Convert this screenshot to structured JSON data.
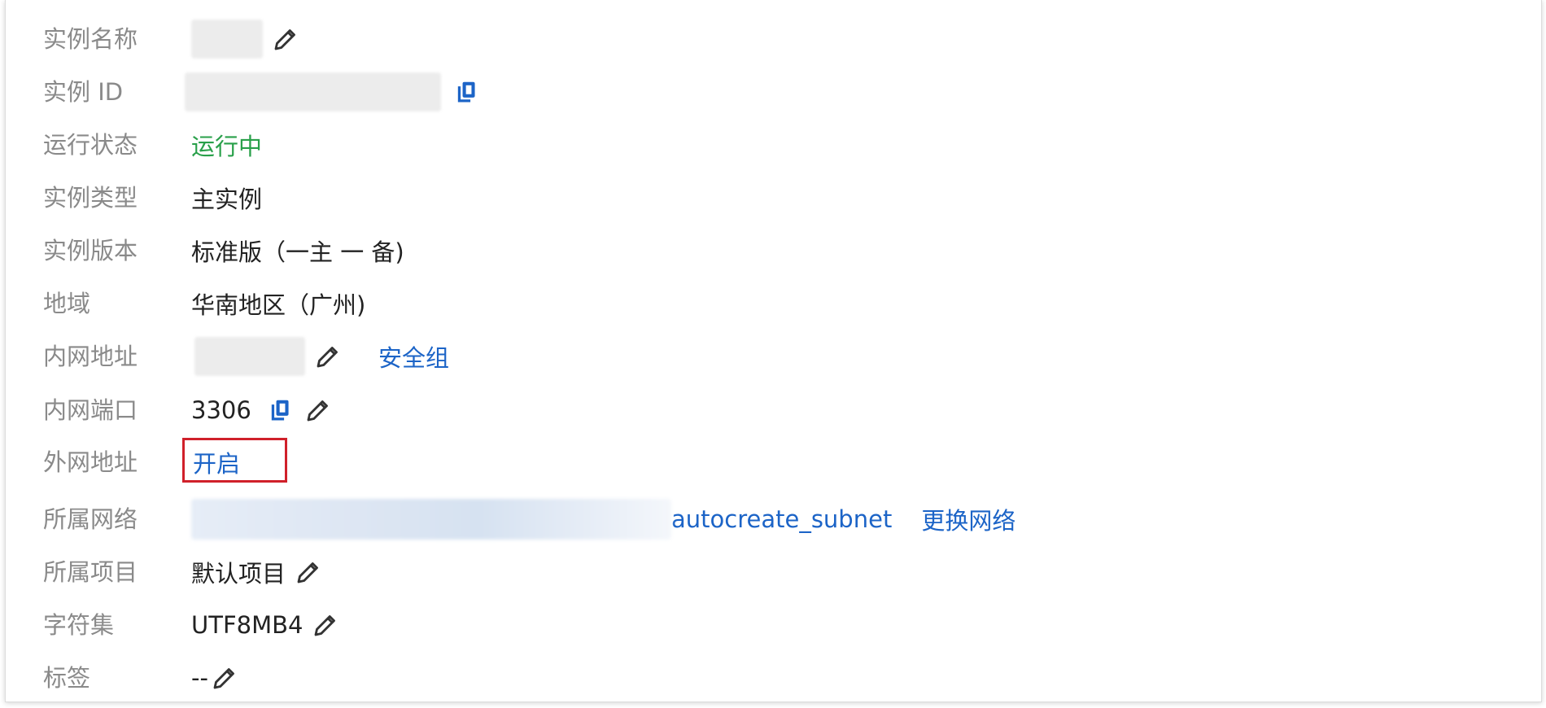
{
  "rows": {
    "instance_name": {
      "label": "实例名称"
    },
    "instance_id": {
      "label": "实例 ID"
    },
    "status": {
      "label": "运行状态",
      "value": "运行中"
    },
    "instance_type": {
      "label": "实例类型",
      "value": "主实例"
    },
    "edition": {
      "label": "实例版本",
      "value": "标准版（一主 一 备)"
    },
    "region": {
      "label": "地域",
      "value": "华南地区（广州)"
    },
    "private_ip": {
      "label": "内网地址",
      "link": "安全组"
    },
    "private_port": {
      "label": "内网端口",
      "value": "3306"
    },
    "public_ip": {
      "label": "外网地址",
      "link": "开启"
    },
    "network": {
      "label": "所属网络",
      "value": "autocreate_subnet",
      "link": "更换网络"
    },
    "project": {
      "label": "所属项目",
      "value": "默认项目"
    },
    "charset": {
      "label": "字符集",
      "value": "UTF8MB4"
    },
    "tags": {
      "label": "标签",
      "value": "--"
    }
  },
  "colors": {
    "label": "#8a8a8a",
    "value": "#222222",
    "status_running": "#29a04a",
    "link": "#1c64c7",
    "highlight": "#d0202a"
  },
  "icons": {
    "edit": "pencil-icon",
    "copy": "copy-icon"
  }
}
